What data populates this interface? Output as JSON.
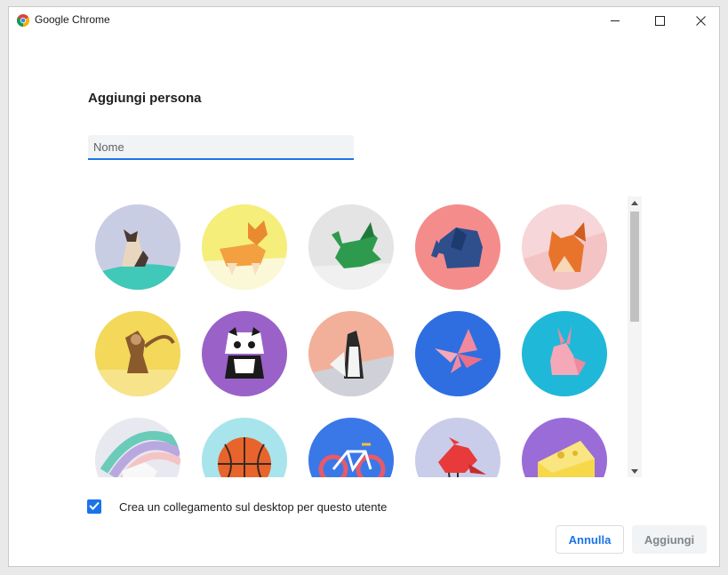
{
  "window": {
    "app_title": "Google Chrome",
    "app_icon": "chrome-logo-icon",
    "controls": [
      "minimize-icon",
      "maximize-icon",
      "close-icon"
    ]
  },
  "dialog": {
    "title": "Aggiungi persona",
    "name_input": {
      "value": "",
      "placeholder": "Nome"
    },
    "avatars": [
      {
        "name": "cat",
        "bg": "#c9cde3",
        "accent": "#40c8b8"
      },
      {
        "name": "corgi",
        "bg": "#f5ee7a",
        "accent": "#f2a040"
      },
      {
        "name": "dragon",
        "bg": "#e4e4e4",
        "accent": "#2e9a4e"
      },
      {
        "name": "elephant",
        "bg": "#f58c8c",
        "accent": "#2e4f8c"
      },
      {
        "name": "fox",
        "bg": "#f6d6d8",
        "accent": "#e8742c"
      },
      {
        "name": "monkey",
        "bg": "#f3d85a",
        "accent": "#8a5a2c"
      },
      {
        "name": "panda",
        "bg": "#9a62c8",
        "accent": "#1a1a1a"
      },
      {
        "name": "penguin",
        "bg": "#f2b09a",
        "accent": "#2a2a2a"
      },
      {
        "name": "butterfly",
        "bg": "#2e6ee0",
        "accent": "#f08aa0"
      },
      {
        "name": "rabbit",
        "bg": "#20b8d8",
        "accent": "#f4a8b8"
      },
      {
        "name": "unicorn",
        "bg": "#d8d8e8",
        "accent": "#6acbb8"
      },
      {
        "name": "basketball",
        "bg": "#a8e4ec",
        "accent": "#e8642c"
      },
      {
        "name": "bicycle",
        "bg": "#3a78e8",
        "accent": "#e85a6a"
      },
      {
        "name": "bird",
        "bg": "#c9cdea",
        "accent": "#e83a3a"
      },
      {
        "name": "cheese",
        "bg": "#9a6cd8",
        "accent": "#f6d84a"
      }
    ],
    "shortcut_checkbox": {
      "checked": true,
      "label": "Crea un collegamento sul desktop per questo utente"
    },
    "buttons": {
      "cancel": "Annulla",
      "add": "Aggiungi"
    }
  },
  "colors": {
    "accent": "#1a73e8",
    "disabled_bg": "#f1f3f4",
    "disabled_text": "#80868b"
  }
}
